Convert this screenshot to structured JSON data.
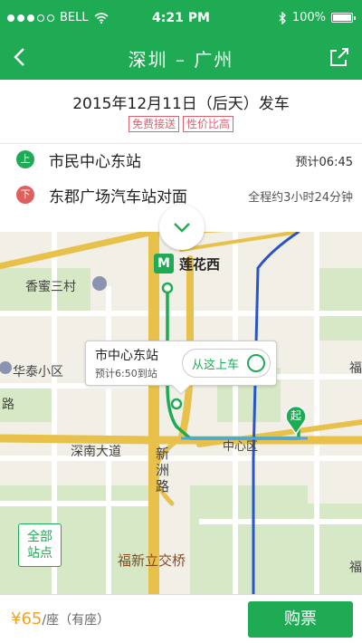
{
  "status_bar": {
    "carrier": "BELL",
    "time": "4:21 PM",
    "battery": "100%"
  },
  "nav": {
    "title": "深圳 – 广州"
  },
  "trip": {
    "date": "2015年12月11日（后天）发车",
    "tags": [
      "免费接送",
      "性价比高"
    ],
    "board": {
      "badge": "上",
      "name": "市民中心东站",
      "info": "预计06:45"
    },
    "alight": {
      "badge": "下",
      "name": "东郡广场汽车站对面",
      "info": "全程约3小时24分钟"
    }
  },
  "map": {
    "metro_station": "莲花西",
    "metro_icon": "M",
    "labels": {
      "xiangmi": "香蜜三村",
      "huatai": "华泰小区",
      "lu": "路",
      "shennan": "深南大道",
      "xinzhou": "新\n洲\n路",
      "fuxin": "福新立交桥",
      "zhongxin": "中心区",
      "fu1": "福",
      "fu2": "福"
    },
    "callout": {
      "name": "市中心东站",
      "eta": "预计6:50到站",
      "board_button": "从这上车"
    },
    "qi_pin": "起",
    "all_stops_button": "全部\n站点"
  },
  "footer": {
    "price_amount": "¥65",
    "price_unit": "/座（有座）",
    "buy_button": "购票"
  },
  "colors": {
    "brand_green": "#1fab54",
    "tag_red": "#e06070",
    "price_orange": "#f5a21a"
  }
}
